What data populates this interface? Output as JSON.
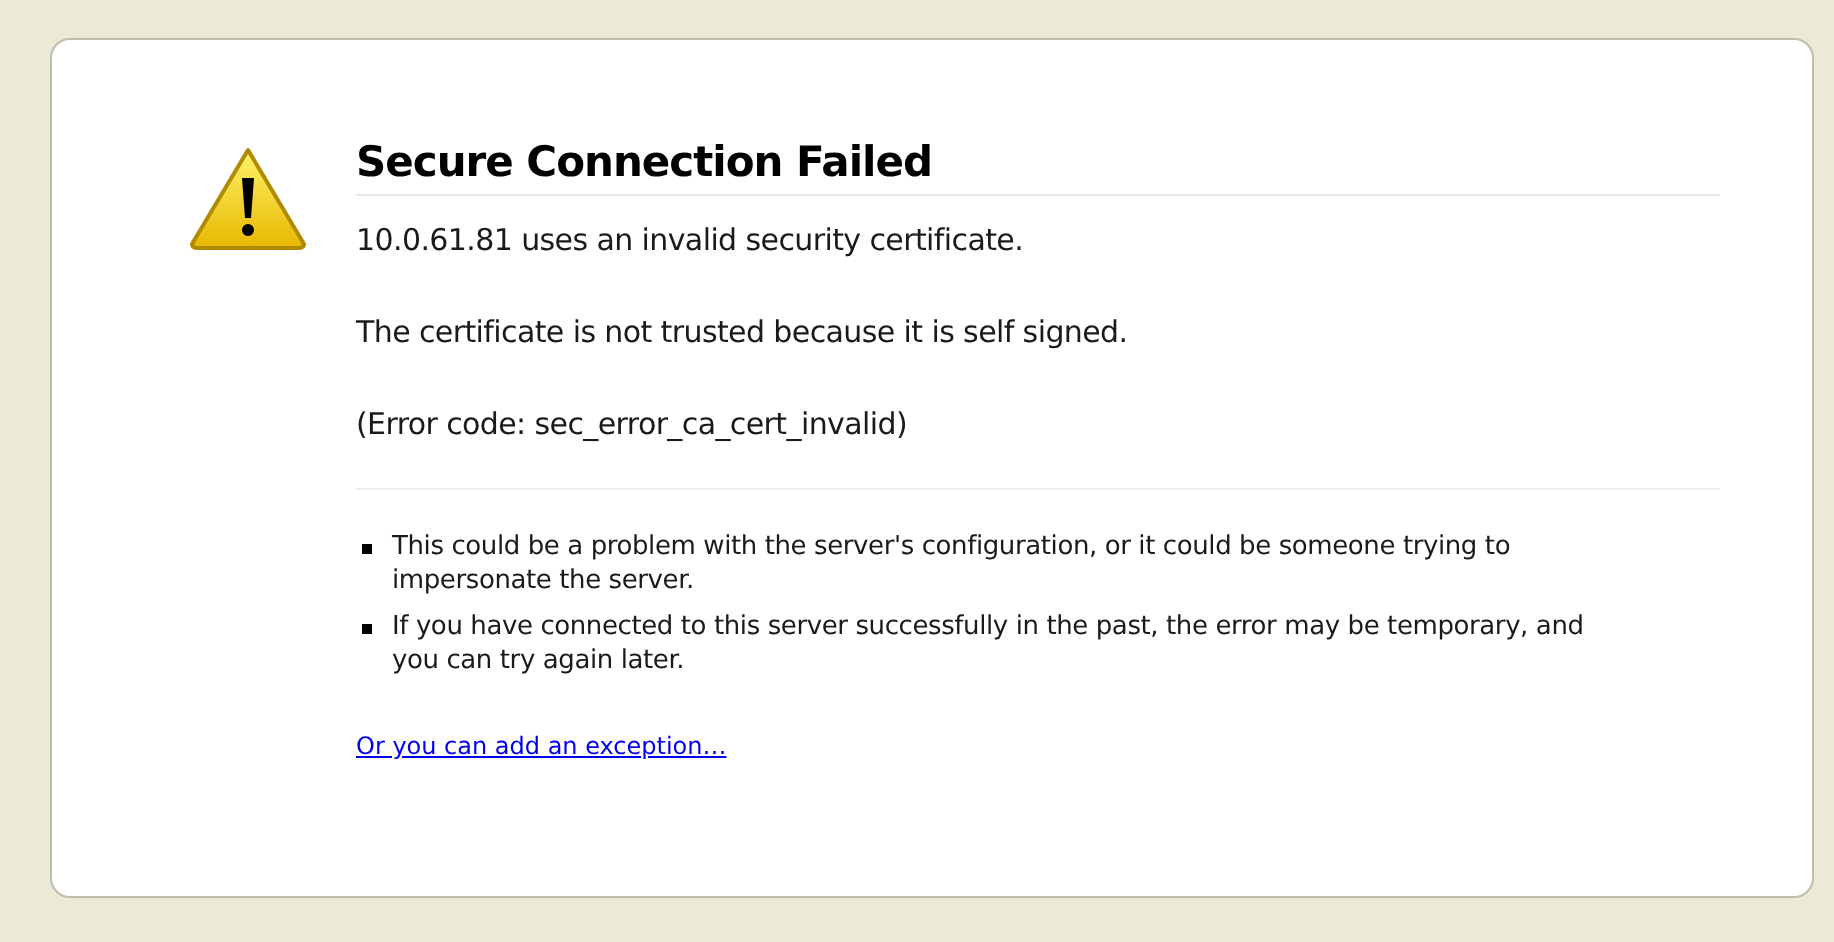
{
  "title": "Secure Connection Failed",
  "paragraphs": [
    "10.0.61.81 uses an invalid security certificate.",
    "The certificate is not trusted because it is self signed.",
    "(Error code: sec_error_ca_cert_invalid)"
  ],
  "bullets": [
    "This could be a problem with the server's configuration, or it could be someone trying to impersonate the server.",
    "If you have connected to this server successfully in the past, the error may be temporary, and you can try again later."
  ],
  "link": "Or you can add an exception…"
}
